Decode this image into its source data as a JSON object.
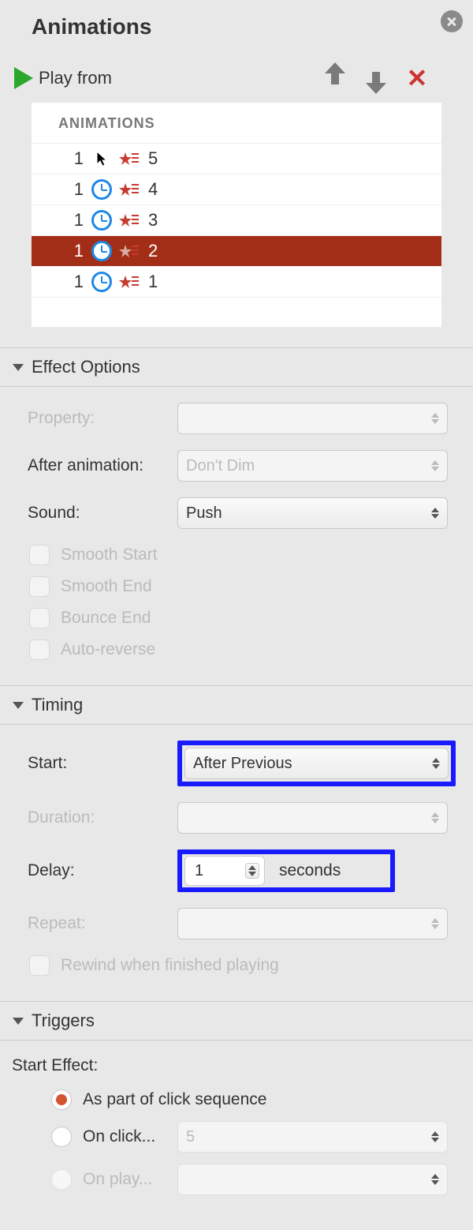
{
  "title": "Animations",
  "toolbar": {
    "play_label": "Play from"
  },
  "list": {
    "header": "ANIMATIONS",
    "rows": [
      {
        "num": "1",
        "trigger": "click",
        "label": "5",
        "selected": false
      },
      {
        "num": "1",
        "trigger": "clock",
        "label": "4",
        "selected": false
      },
      {
        "num": "1",
        "trigger": "clock",
        "label": "3",
        "selected": false
      },
      {
        "num": "1",
        "trigger": "clock",
        "label": "2",
        "selected": true
      },
      {
        "num": "1",
        "trigger": "clock",
        "label": "1",
        "selected": false
      }
    ]
  },
  "effect_options": {
    "title": "Effect Options",
    "property_label": "Property:",
    "after_anim_label": "After animation:",
    "after_anim_value": "Don't Dim",
    "sound_label": "Sound:",
    "sound_value": "Push",
    "smooth_start": "Smooth Start",
    "smooth_end": "Smooth End",
    "bounce_end": "Bounce End",
    "auto_reverse": "Auto-reverse"
  },
  "timing": {
    "title": "Timing",
    "start_label": "Start:",
    "start_value": "After Previous",
    "duration_label": "Duration:",
    "delay_label": "Delay:",
    "delay_value": "1",
    "delay_unit": "seconds",
    "repeat_label": "Repeat:",
    "rewind_label": "Rewind when finished playing"
  },
  "triggers": {
    "title": "Triggers",
    "start_effect_label": "Start Effect:",
    "opt_click_seq": "As part of click sequence",
    "opt_on_click": "On click...",
    "on_click_value": "5",
    "opt_on_play": "On play..."
  }
}
